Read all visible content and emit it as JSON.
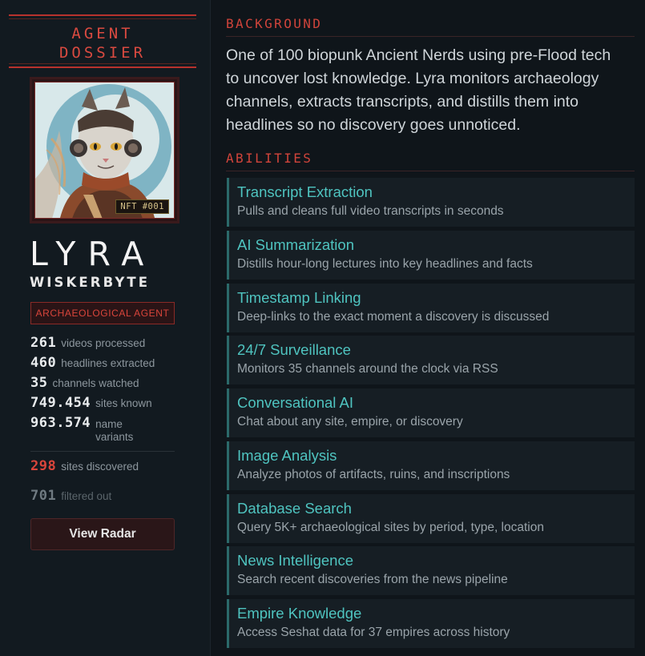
{
  "sidebar": {
    "title_line1": "AGENT",
    "title_line2": "DOSSIER",
    "nft_badge": "NFT #001",
    "name": "LYRA",
    "surname": "WISKERBYTE",
    "role": "ARCHAEOLOGICAL AGENT",
    "stats": [
      {
        "value": "261",
        "label": "videos processed"
      },
      {
        "value": "460",
        "label": "headlines extracted"
      },
      {
        "value": "35",
        "label": "channels watched"
      },
      {
        "value": "749.454",
        "label": "sites known"
      },
      {
        "value": "963.574",
        "label": "name variants"
      }
    ],
    "sites_discovered": {
      "value": "298",
      "label": "sites discovered"
    },
    "filtered_out": {
      "value": "701",
      "label": "filtered out"
    },
    "radar_button": "View Radar"
  },
  "main": {
    "background_heading": "BACKGROUND",
    "background_text": "One of 100 biopunk Ancient Nerds using pre-Flood tech to uncover lost knowledge. Lyra monitors archaeology channels, extracts transcripts, and distills them into headlines so no discovery goes unnoticed.",
    "abilities_heading": "ABILITIES",
    "abilities": [
      {
        "title": "Transcript Extraction",
        "desc": "Pulls and cleans full video transcripts in seconds"
      },
      {
        "title": "AI Summarization",
        "desc": "Distills hour-long lectures into key headlines and facts"
      },
      {
        "title": "Timestamp Linking",
        "desc": "Deep-links to the exact moment a discovery is discussed"
      },
      {
        "title": "24/7 Surveillance",
        "desc": "Monitors 35 channels around the clock via RSS"
      },
      {
        "title": "Conversational AI",
        "desc": "Chat about any site, empire, or discovery"
      },
      {
        "title": "Image Analysis",
        "desc": "Analyze photos of artifacts, ruins, and inscriptions"
      },
      {
        "title": "Database Search",
        "desc": "Query 5K+ archaeological sites by period, type, location"
      },
      {
        "title": "News Intelligence",
        "desc": "Search recent discoveries from the news pipeline"
      },
      {
        "title": "Empire Knowledge",
        "desc": "Access Seshat data for 37 empires across history"
      }
    ]
  },
  "colors": {
    "accent_red": "#d9453b",
    "accent_teal": "#4fc4c0",
    "background": "#0f151a"
  }
}
